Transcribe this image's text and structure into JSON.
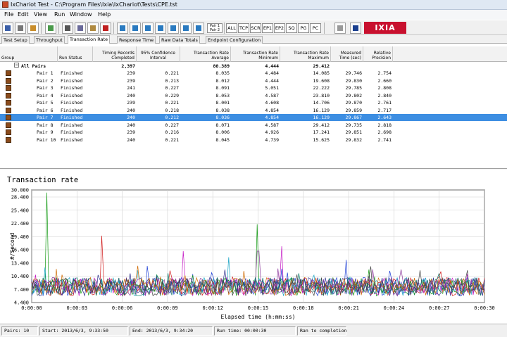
{
  "window": {
    "title": "IxChariot Test - C:\\Program Files\\Ixia\\IxChariot\\Tests\\CPE.tst"
  },
  "menu": [
    "File",
    "Edit",
    "View",
    "Run",
    "Window",
    "Help"
  ],
  "toolbar": {
    "protocol_buttons": [
      "ALL",
      "TCP",
      "SCR",
      "EP1",
      "EP2",
      "SQ",
      "PG",
      "PC"
    ],
    "pair_button": "Pair 1 Pair 2",
    "logo": "IXIA",
    "logo_color": "#c8102e"
  },
  "tabs": [
    "Test Setup",
    "Throughput",
    "Transaction Rate",
    "Response Time",
    "Raw Data Totals",
    "Endpoint Configuration"
  ],
  "active_tab": "Transaction Rate",
  "grid": {
    "headers": {
      "group": "Group",
      "run_status": "Run Status",
      "timing_records": "Timing Records Completed",
      "confidence": "95% Confidence Interval",
      "avg": "Transaction Rate Average",
      "min": "Transaction Rate Minimum",
      "max": "Transaction Rate Maximum",
      "time": "Measured Time (sec)",
      "precision": "Relative Precision"
    },
    "all_pairs": {
      "label": "All Pairs",
      "records": "2,397",
      "avg": "80.389",
      "min": "4.444",
      "max": "29.412"
    },
    "rows": [
      {
        "pair": "Pair 1",
        "status": "Finished",
        "records": "239",
        "conf": "0.221",
        "avg": "8.035",
        "min": "4.484",
        "max": "14.085",
        "time": "29.746",
        "prec": "2.754"
      },
      {
        "pair": "Pair 2",
        "status": "Finished",
        "records": "239",
        "conf": "0.213",
        "avg": "8.012",
        "min": "4.444",
        "max": "19.608",
        "time": "29.830",
        "prec": "2.660"
      },
      {
        "pair": "Pair 3",
        "status": "Finished",
        "records": "241",
        "conf": "0.227",
        "avg": "8.091",
        "min": "5.051",
        "max": "22.222",
        "time": "29.785",
        "prec": "2.808"
      },
      {
        "pair": "Pair 4",
        "status": "Finished",
        "records": "240",
        "conf": "0.229",
        "avg": "8.053",
        "min": "4.587",
        "max": "23.810",
        "time": "29.802",
        "prec": "2.840"
      },
      {
        "pair": "Pair 5",
        "status": "Finished",
        "records": "239",
        "conf": "0.221",
        "avg": "8.001",
        "min": "4.608",
        "max": "14.706",
        "time": "29.870",
        "prec": "2.761"
      },
      {
        "pair": "Pair 6",
        "status": "Finished",
        "records": "240",
        "conf": "0.218",
        "avg": "8.038",
        "min": "4.854",
        "max": "16.129",
        "time": "29.859",
        "prec": "2.717"
      },
      {
        "pair": "Pair 7",
        "status": "Finished",
        "records": "240",
        "conf": "0.212",
        "avg": "8.036",
        "min": "4.854",
        "max": "16.129",
        "time": "29.867",
        "prec": "2.643"
      },
      {
        "pair": "Pair 8",
        "status": "Finished",
        "records": "240",
        "conf": "0.227",
        "avg": "8.071",
        "min": "4.587",
        "max": "29.412",
        "time": "29.735",
        "prec": "2.818"
      },
      {
        "pair": "Pair 9",
        "status": "Finished",
        "records": "239",
        "conf": "0.216",
        "avg": "8.006",
        "min": "4.926",
        "max": "17.241",
        "time": "29.851",
        "prec": "2.698"
      },
      {
        "pair": "Pair 10",
        "status": "Finished",
        "records": "240",
        "conf": "0.221",
        "avg": "8.045",
        "min": "4.739",
        "max": "15.625",
        "time": "29.832",
        "prec": "2.741"
      }
    ],
    "selected_row": 6,
    "selection_color": "#3d8ee2"
  },
  "chart_data": {
    "type": "line",
    "title": "Transaction rate",
    "xlabel": "Elapsed time (h:mm:ss)",
    "ylabel": "#/Second",
    "ylim": [
      4.4,
      30.0
    ],
    "xlim": [
      0,
      30
    ],
    "grid": true,
    "y_ticks": [
      "30.000",
      "28.400",
      "25.400",
      "22.400",
      "19.400",
      "16.400",
      "13.400",
      "10.400",
      "7.400",
      "4.400"
    ],
    "x_ticks": [
      "0:00:00",
      "0:00:03",
      "0:00:06",
      "0:00:09",
      "0:00:12",
      "0:00:15",
      "0:00:18",
      "0:00:21",
      "0:00:24",
      "0:00:27",
      "0:00:30"
    ],
    "series_colors": [
      "#1d3fd6",
      "#d01a1a",
      "#139a13",
      "#c415c4",
      "#15a3c4",
      "#2b2b8a",
      "#8c3a9c",
      "#0a7a6a",
      "#d06a00",
      "#444444"
    ],
    "spikes": [
      {
        "series": 2,
        "x": 1.0,
        "y": 29.4
      },
      {
        "series": 1,
        "x": 4.6,
        "y": 19.6
      },
      {
        "series": 2,
        "x": 14.9,
        "y": 22.2
      },
      {
        "series": 3,
        "x": 10.0,
        "y": 16.1
      },
      {
        "series": 4,
        "x": 13.1,
        "y": 14.7
      },
      {
        "series": 3,
        "x": 16.6,
        "y": 17.2
      },
      {
        "series": 0,
        "x": 20.8,
        "y": 14.1
      },
      {
        "series": 6,
        "x": 15.0,
        "y": 16.1
      }
    ]
  },
  "status": {
    "pairs": "Pairs: 10",
    "start": "Start: 2013/6/3, 9:33:50",
    "end": "End: 2013/6/3, 9:34:20",
    "run_time": "Run time: 00:00:30",
    "state": "Ran to completion"
  }
}
